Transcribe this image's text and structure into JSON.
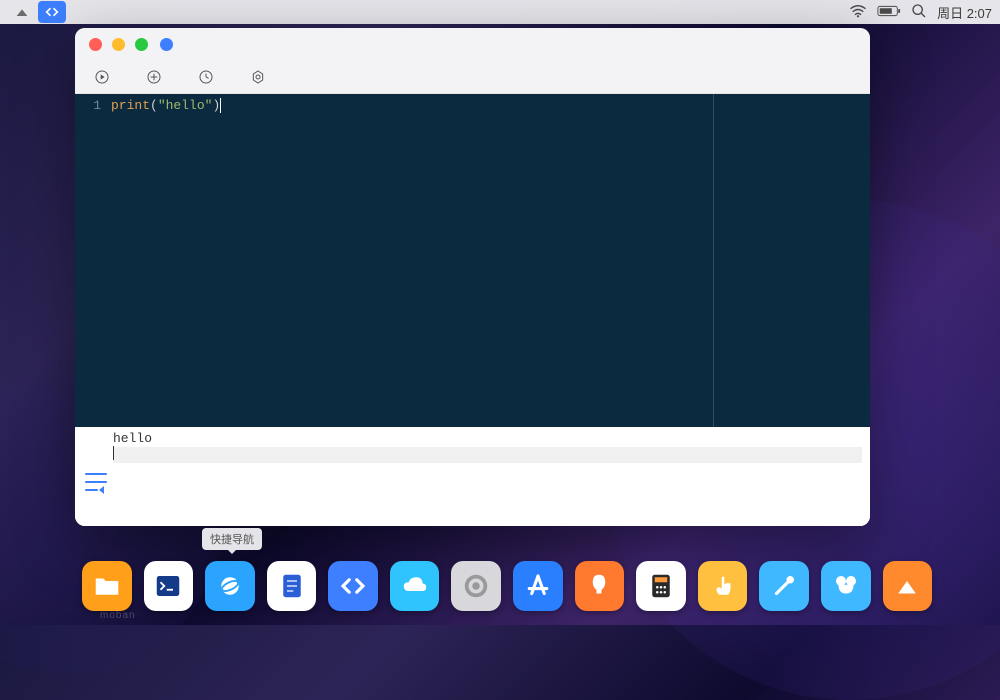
{
  "menubar": {
    "wifi": "wifi",
    "battery": "battery",
    "search": "search",
    "clock": "周日 2:07"
  },
  "window": {
    "toolbar": {
      "run": "run",
      "add": "add",
      "history": "history",
      "settings": "settings"
    },
    "editor": {
      "line_numbers": [
        "1"
      ],
      "code": {
        "fn": "print",
        "open": "(",
        "str": "\"hello\"",
        "close": ")"
      }
    },
    "output": {
      "text": "hello"
    }
  },
  "dock": {
    "tooltip": "快捷导航",
    "items": [
      {
        "name": "files",
        "bg": "#ff9f1a"
      },
      {
        "name": "terminal",
        "bg": "#ffffff"
      },
      {
        "name": "browser",
        "bg": "#2aa4ff"
      },
      {
        "name": "notes",
        "bg": "#ffffff"
      },
      {
        "name": "code",
        "bg": "#3d7fff"
      },
      {
        "name": "cloud",
        "bg": "#30c4ff"
      },
      {
        "name": "system-settings",
        "bg": "#d8d8dc"
      },
      {
        "name": "app-store",
        "bg": "#2a7fff"
      },
      {
        "name": "tips",
        "bg": "#ff7a2e"
      },
      {
        "name": "calculator",
        "bg": "#ffffff"
      },
      {
        "name": "touch",
        "bg": "#ffc040"
      },
      {
        "name": "tools",
        "bg": "#40b8ff"
      },
      {
        "name": "games",
        "bg": "#40b8ff"
      },
      {
        "name": "home",
        "bg": "#ff8a2e"
      }
    ]
  },
  "faded_text": "moban"
}
